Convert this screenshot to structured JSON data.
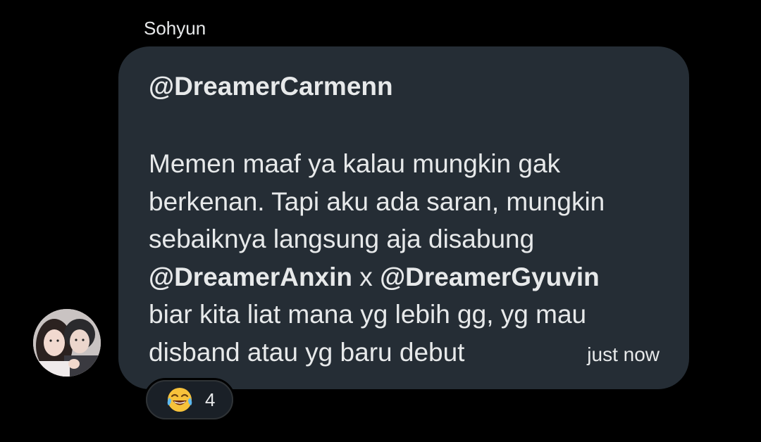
{
  "conversation": {
    "sender_name": "Sohyun"
  },
  "message": {
    "mention_header": "@DreamerCarmenn",
    "lines": [
      {
        "text": "Memen maaf ya kalau mungkin gak"
      },
      {
        "text": "berkenan. Tapi aku ada saran, mungkin"
      },
      {
        "text": "sebaiknya langsung aja disabung"
      },
      {
        "mention_a": "@DreamerAnxin",
        "sep": " x ",
        "mention_b": "@DreamerGyuvin"
      },
      {
        "text": "biar kita liat mana yg lebih gg, yg mau"
      },
      {
        "text": "disband atau yg baru debut"
      }
    ],
    "timestamp": "just now"
  },
  "reaction": {
    "emoji_icon": "face-with-tears-of-joy-icon",
    "count": "4"
  },
  "colors": {
    "background": "#000000",
    "bubble": "#252d35",
    "text": "#e7e9ea"
  }
}
